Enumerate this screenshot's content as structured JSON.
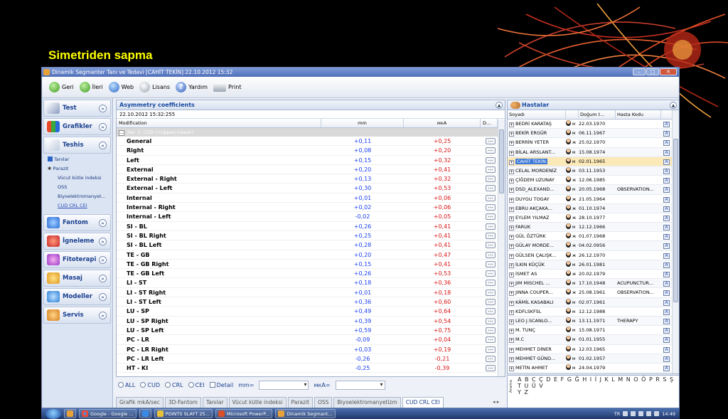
{
  "slide_title": "Simetriden sapma",
  "window": {
    "title": "Dinamik Segmanter Tanı ve Tedavi [CAHİT TEKİN] 22.10.2012 15:32"
  },
  "toolbar": {
    "back": "Geri",
    "forward": "İleri",
    "web": "Web",
    "license": "Lisans",
    "help": "Yardım",
    "print": "Print"
  },
  "sidebar": {
    "test": "Test",
    "grafikler": "Grafikler",
    "teshis": "Teshis",
    "teshis_items": [
      "Tanılar",
      "Parazit",
      "Vücut kütle indeksi",
      "OSS",
      "Biyoelektromanyet...",
      "CUD CRL CEI"
    ],
    "fantom": "Fantom",
    "igneleme": "İgneleme",
    "fitoterapi": "Fitoterapi",
    "masaj": "Masaj",
    "modeller": "Modeller",
    "servis": "Servis"
  },
  "main": {
    "title": "Asymmetry coefficients",
    "date": "22.10.2012 15:32:255",
    "columns": {
      "name": "Modification",
      "mm": "mm",
      "mka": "мкА",
      "d": "D..."
    },
    "group_label": "Ser. 1. CUD (+Upper/-Lower)",
    "dots": "...",
    "rows": [
      {
        "name": "General",
        "mm": "+0,11",
        "mka": "+0,25"
      },
      {
        "name": "Right",
        "mm": "+0,08",
        "mka": "+0,20"
      },
      {
        "name": "Left",
        "mm": "+0,15",
        "mka": "+0,32"
      },
      {
        "name": "External",
        "mm": "+0,20",
        "mka": "+0,41"
      },
      {
        "name": "External - Right",
        "mm": "+0,13",
        "mka": "+0,32"
      },
      {
        "name": "External - Left",
        "mm": "+0,30",
        "mka": "+0,53"
      },
      {
        "name": "Internal",
        "mm": "+0,01",
        "mka": "+0,06"
      },
      {
        "name": "Internal - Right",
        "mm": "+0,02",
        "mka": "+0,06"
      },
      {
        "name": "Internal - Left",
        "mm": "-0,02",
        "mka": "+0,05"
      },
      {
        "name": "SI - BL",
        "mm": "+0,26",
        "mka": "+0,41"
      },
      {
        "name": "SI - BL Right",
        "mm": "+0,25",
        "mka": "+0,41"
      },
      {
        "name": "SI - BL Left",
        "mm": "+0,28",
        "mka": "+0,41"
      },
      {
        "name": "TE - GB",
        "mm": "+0,20",
        "mka": "+0,47"
      },
      {
        "name": "TE - GB Right",
        "mm": "+0,15",
        "mka": "+0,41"
      },
      {
        "name": "TE - GB Left",
        "mm": "+0,26",
        "mka": "+0,53"
      },
      {
        "name": "LI - ST",
        "mm": "+0,18",
        "mka": "+0,36"
      },
      {
        "name": "LI - ST Right",
        "mm": "+0,01",
        "mka": "+0,18"
      },
      {
        "name": "LI - ST Left",
        "mm": "+0,36",
        "mka": "+0,60"
      },
      {
        "name": "LU - SP",
        "mm": "+0,49",
        "mka": "+0,64"
      },
      {
        "name": "LU - SP Right",
        "mm": "+0,39",
        "mka": "+0,54"
      },
      {
        "name": "LU - SP Left",
        "mm": "+0,59",
        "mka": "+0,75"
      },
      {
        "name": "PC - LR",
        "mm": "-0,09",
        "mka": "+0,04"
      },
      {
        "name": "PC - LR Right",
        "mm": "+0,03",
        "mka": "+0,19"
      },
      {
        "name": "PC - LR Left",
        "mm": "-0,26",
        "mka": "-0,21"
      },
      {
        "name": "HT - KI",
        "mm": "-0,25",
        "mka": "-0,39"
      }
    ]
  },
  "filters": {
    "all": "ALL",
    "cud": "CUD",
    "crl": "CRL",
    "cei": "CEI",
    "detail": "Detail",
    "mm_label": "mm=",
    "mka_label": "мкА="
  },
  "tabs": [
    "Grafik mkA/sec",
    "3D-Fantom",
    "Tanılar",
    "Vücut kütle indeksi",
    "Parazit",
    "OSS",
    "Biyoelektromanyetizm",
    "CUD CRL CEI"
  ],
  "tab_arrows": "◂ ▸",
  "patients": {
    "title": "Hastalar",
    "columns": {
      "surname": "Soyadı",
      "dob": "Doğum t...",
      "code": "Hasta Kodu"
    },
    "rows": [
      {
        "name": "BEDRİ KARATAŞ",
        "g": "м",
        "dob": "22.03.1970",
        "code": ""
      },
      {
        "name": "BEKİR ERGÜR",
        "g": "м",
        "dob": "06.11.1967",
        "code": ""
      },
      {
        "name": "BERRİN YETER",
        "g": "ж",
        "dob": "25.02.1970",
        "code": ""
      },
      {
        "name": "BİLAL ARSLANT...",
        "g": "м",
        "dob": "15.08.1974",
        "code": ""
      },
      {
        "name": "CAHİT TEKİN",
        "g": "м",
        "dob": "02.01.1965",
        "code": ""
      },
      {
        "name": "CELAL MORDENİZ",
        "g": "м",
        "dob": "03.11.1953",
        "code": ""
      },
      {
        "name": "ÇİĞDEM UZUNAY",
        "g": "ж",
        "dob": "12.06.1985",
        "code": ""
      },
      {
        "name": "DSD_ALEXAND...",
        "g": "м",
        "dob": "20.05.1968",
        "code": "OBSERVATION..."
      },
      {
        "name": "DUYGU TOGAY",
        "g": "ж",
        "dob": "21.05.1964",
        "code": ""
      },
      {
        "name": "EBRU AKÇAKA...",
        "g": "ж",
        "dob": "01.10.1974",
        "code": ""
      },
      {
        "name": "EYLEM YILMAZ",
        "g": "ж",
        "dob": "28.10.1977",
        "code": ""
      },
      {
        "name": "FARUK",
        "g": "м",
        "dob": "12.12.1966",
        "code": ""
      },
      {
        "name": "GÜL ÖZTÜRK",
        "g": "ж",
        "dob": "01.07.1968",
        "code": ""
      },
      {
        "name": "GÜLAY MORDE...",
        "g": "ж",
        "dob": "04.02.0956",
        "code": ""
      },
      {
        "name": "GÜLSEN ÇALIŞK...",
        "g": "ж",
        "dob": "26.12.1970",
        "code": ""
      },
      {
        "name": "İLKIN KÜÇÜK",
        "g": "м",
        "dob": "26.01.1981",
        "code": ""
      },
      {
        "name": "İSMET AS",
        "g": "ж",
        "dob": "20.02.1979",
        "code": ""
      },
      {
        "name": "JIM MISCHEL ...",
        "g": "м",
        "dob": "17.10.1948",
        "code": "ACUPUNCTUR..."
      },
      {
        "name": "JINNA COUPER...",
        "g": "ж",
        "dob": "25.08.1961",
        "code": "OBSERVATION..."
      },
      {
        "name": "KÂMİL KASABALI",
        "g": "м",
        "dob": "02.07.1961",
        "code": ""
      },
      {
        "name": "KDFLSKFSL",
        "g": "м",
        "dob": "12.12.1988",
        "code": ""
      },
      {
        "name": "LEO J.SCANLO...",
        "g": "м",
        "dob": "13.11.1971",
        "code": "THERAPY"
      },
      {
        "name": "M. TUNÇ",
        "g": "м",
        "dob": "15.08.1971",
        "code": ""
      },
      {
        "name": "M.C",
        "g": "м",
        "dob": "01.01.1955",
        "code": ""
      },
      {
        "name": "MEHMET DİNER",
        "g": "м",
        "dob": "12.03.1965",
        "code": ""
      },
      {
        "name": "MEHMET GÜND...",
        "g": "м",
        "dob": "01.02.1957",
        "code": ""
      },
      {
        "name": "METİN AHMET",
        "g": "м",
        "dob": "24.04.1979",
        "code": ""
      }
    ],
    "selected_index": 4
  },
  "alphabet": {
    "label": "Arama",
    "line1": "A B C Ç D E F G Ğ H I İ J K L M N O Ö P R S Ş T U Ü V",
    "line2": "Y Z"
  },
  "taskbar": {
    "apps": [
      "Google - Google ...",
      "",
      "",
      "POINTS SLAYT 25...",
      "Microsoft PowerP...",
      "Dinamik Segmant..."
    ],
    "lang": "TR",
    "time": "14:49"
  },
  "colors": {
    "title": "#ffff00",
    "mm": "#1a3ff0",
    "mka": "#d81515",
    "selected_row": "#fce9b8"
  }
}
